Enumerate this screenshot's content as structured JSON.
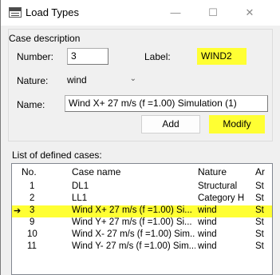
{
  "window": {
    "title": "Load Types",
    "minimize_glyph": "—",
    "maximize_glyph": "☐",
    "close_glyph": "✕"
  },
  "case_description": {
    "group_label": "Case description",
    "number_label": "Number:",
    "number_value": "3",
    "label_label": "Label:",
    "label_value": "WIND2",
    "nature_label": "Nature:",
    "nature_value": "wind",
    "name_label": "Name:",
    "name_value": "Wind X+ 27 m/s (f =1.00) Simulation (1)",
    "add_label": "Add",
    "modify_label": "Modify"
  },
  "list": {
    "group_label": "List of defined cases:",
    "headers": [
      "No.",
      "Case name",
      "Nature",
      "Ar"
    ],
    "rows": [
      {
        "no": "1",
        "name": "DL1",
        "nature": "Structural",
        "an": "St"
      },
      {
        "no": "2",
        "name": "LL1",
        "nature": "Category H",
        "an": "St"
      },
      {
        "no": "3",
        "name": "Wind X+ 27 m/s (f =1.00) Si...",
        "nature": "wind",
        "an": "St",
        "selected": true,
        "marker": "➔"
      },
      {
        "no": "9",
        "name": "Wind Y+ 27 m/s (f =1.00) Si...",
        "nature": "wind",
        "an": "St"
      },
      {
        "no": "10",
        "name": "Wind X- 27 m/s (f =1.00) Sim...",
        "nature": "wind",
        "an": "St"
      },
      {
        "no": "11",
        "name": "Wind Y- 27 m/s (f =1.00) Sim...",
        "nature": "wind",
        "an": "St"
      }
    ]
  },
  "colors": {
    "highlight": "#ffff33",
    "window_bg": "#f0f0f0"
  }
}
